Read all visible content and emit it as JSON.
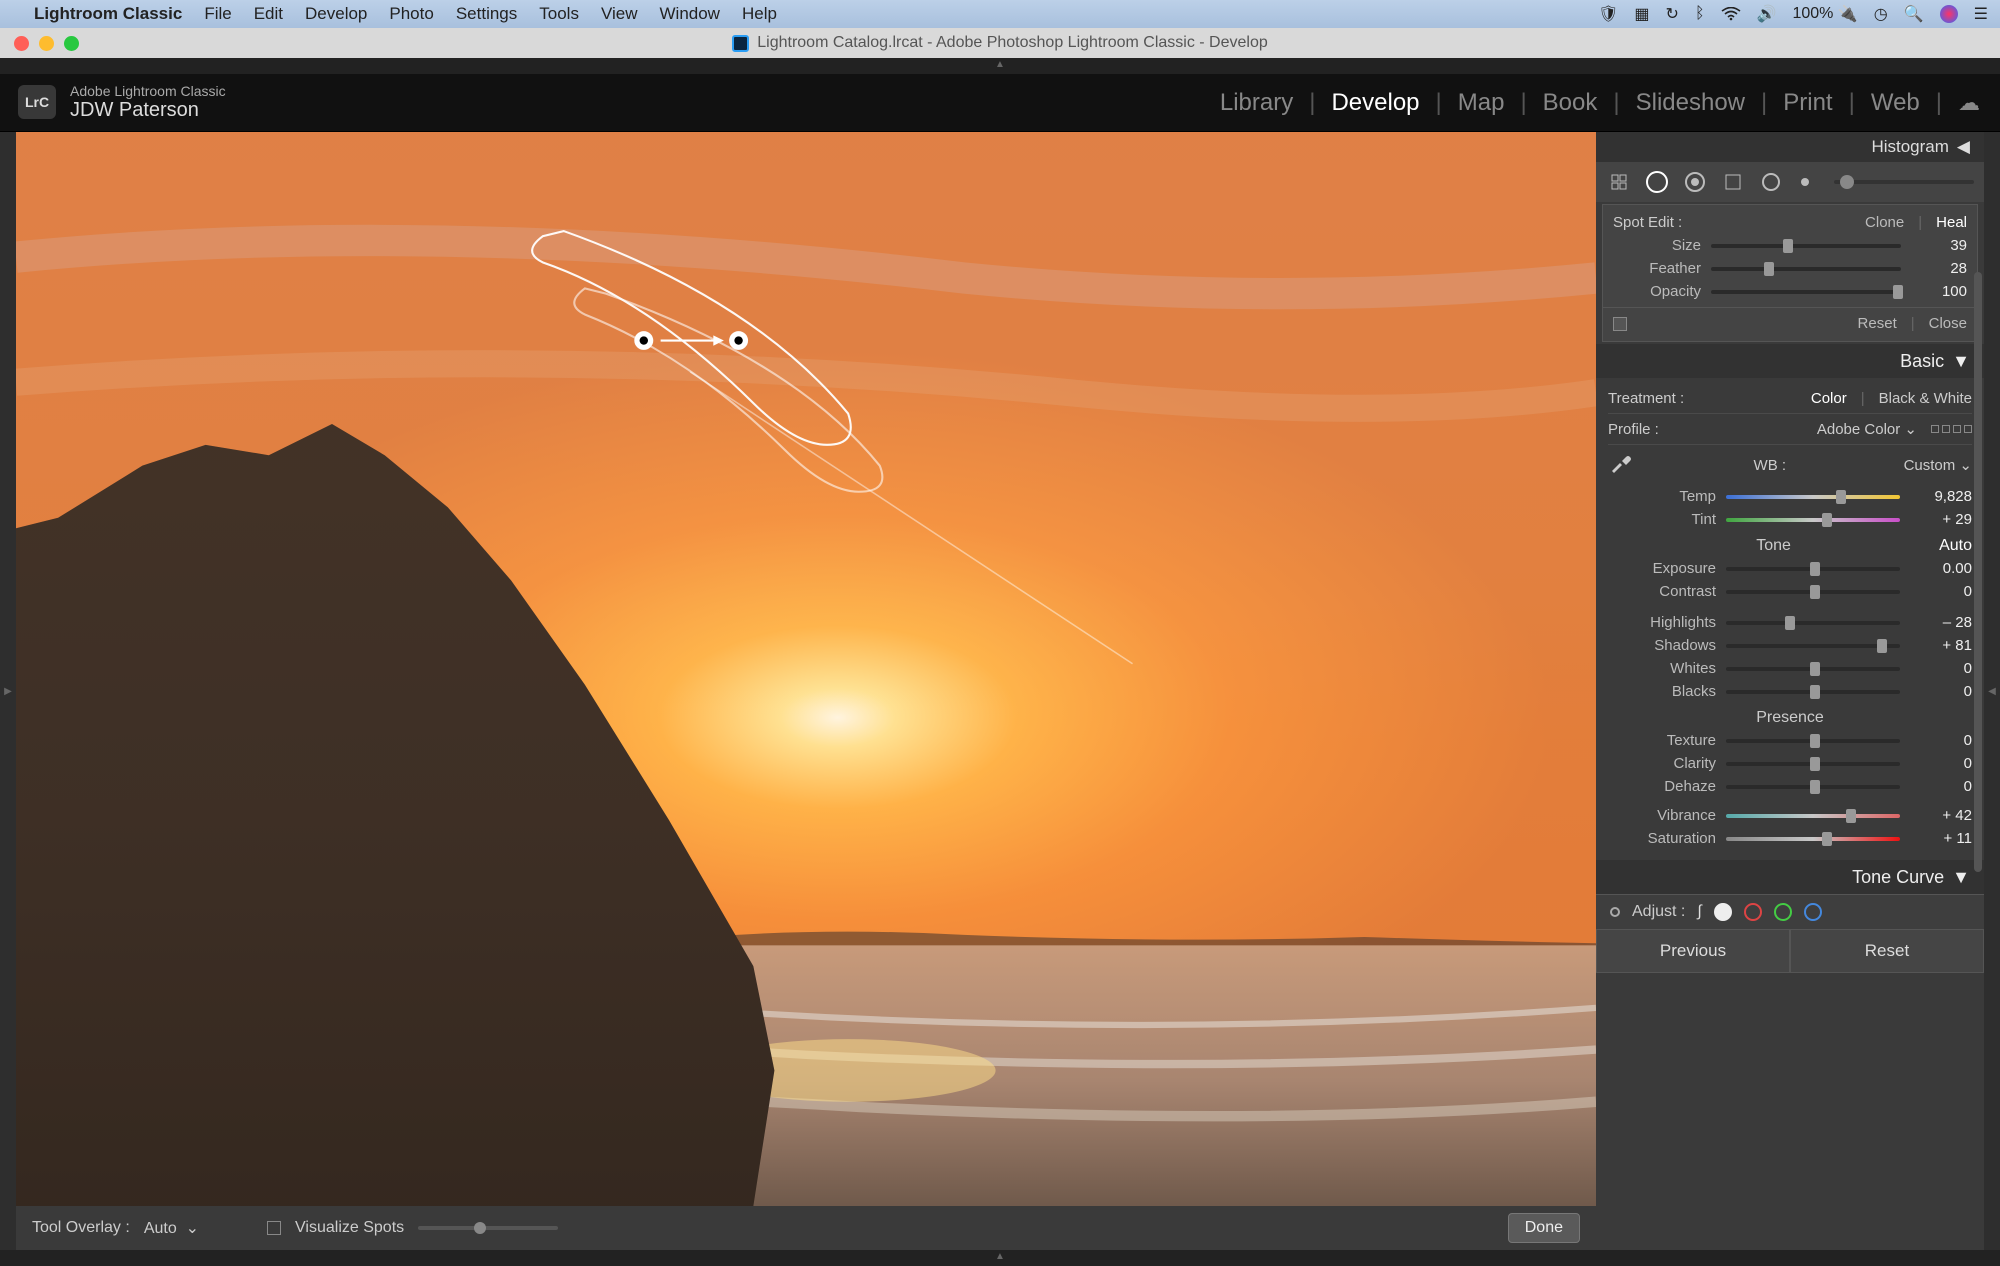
{
  "mac_menubar": {
    "app_name": "Lightroom Classic",
    "items": [
      "File",
      "Edit",
      "Develop",
      "Photo",
      "Settings",
      "Tools",
      "View",
      "Window",
      "Help"
    ],
    "battery": "100%",
    "battery_icon": "🔌"
  },
  "window_title": "Lightroom Catalog.lrcat - Adobe Photoshop Lightroom Classic - Develop",
  "header": {
    "product": "Adobe Lightroom Classic",
    "user": "JDW Paterson",
    "modules": [
      "Library",
      "Develop",
      "Map",
      "Book",
      "Slideshow",
      "Print",
      "Web"
    ],
    "active_module": "Develop"
  },
  "canvas_toolbar": {
    "tool_overlay_label": "Tool Overlay :",
    "tool_overlay_value": "Auto",
    "visualize_spots": "Visualize Spots",
    "done": "Done"
  },
  "right_panel": {
    "histogram": "Histogram",
    "spot": {
      "title": "Spot Edit :",
      "clone": "Clone",
      "heal": "Heal",
      "size_label": "Size",
      "size_val": "39",
      "feather_label": "Feather",
      "feather_val": "28",
      "opacity_label": "Opacity",
      "opacity_val": "100",
      "reset": "Reset",
      "close": "Close"
    },
    "basic": {
      "title": "Basic",
      "treatment_label": "Treatment :",
      "treatment_color": "Color",
      "treatment_bw": "Black & White",
      "profile_label": "Profile :",
      "profile_value": "Adobe Color",
      "wb_label": "WB :",
      "wb_value": "Custom",
      "temp_label": "Temp",
      "temp_val": "9,828",
      "tint_label": "Tint",
      "tint_val": "+ 29",
      "tone": "Tone",
      "auto": "Auto",
      "exposure_label": "Exposure",
      "exposure_val": "0.00",
      "contrast_label": "Contrast",
      "contrast_val": "0",
      "highlights_label": "Highlights",
      "highlights_val": "– 28",
      "shadows_label": "Shadows",
      "shadows_val": "+ 81",
      "whites_label": "Whites",
      "whites_val": "0",
      "blacks_label": "Blacks",
      "blacks_val": "0",
      "presence": "Presence",
      "texture_label": "Texture",
      "texture_val": "0",
      "clarity_label": "Clarity",
      "clarity_val": "0",
      "dehaze_label": "Dehaze",
      "dehaze_val": "0",
      "vibrance_label": "Vibrance",
      "vibrance_val": "+ 42",
      "saturation_label": "Saturation",
      "saturation_val": "+ 11"
    },
    "tone_curve": "Tone Curve",
    "adjust_label": "Adjust :",
    "previous": "Previous",
    "reset": "Reset"
  }
}
